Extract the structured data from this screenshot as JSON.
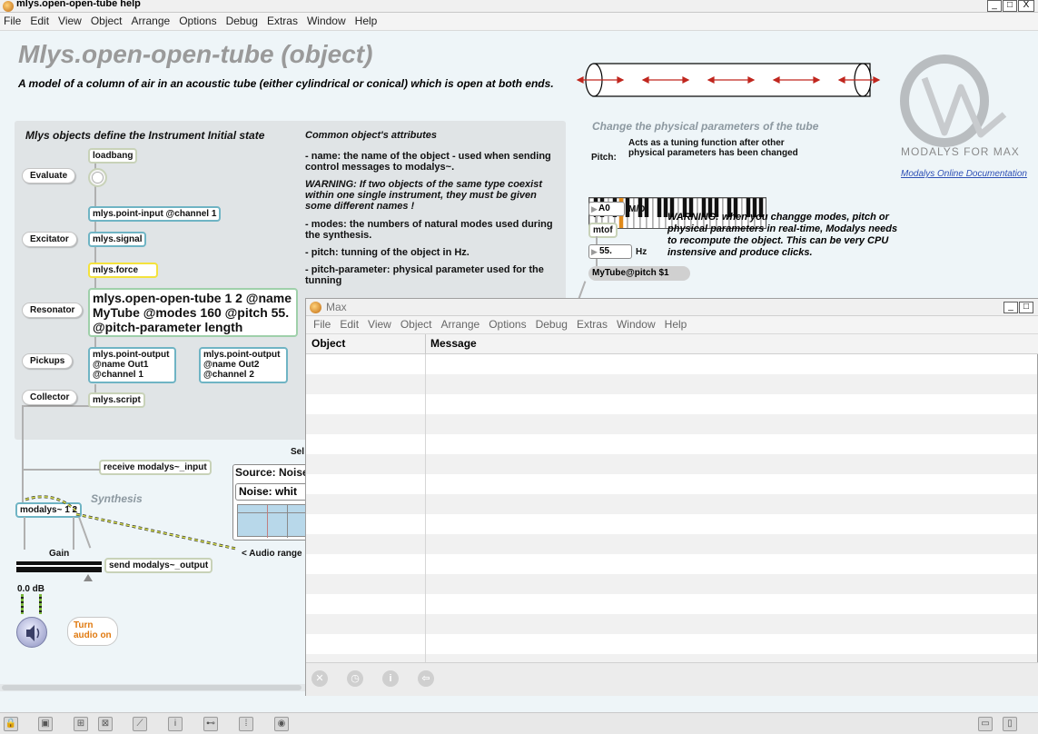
{
  "window": {
    "title": "mlys.open-open-tube help",
    "buttons": {
      "minimize": "_",
      "maximize": "□",
      "close": "X"
    }
  },
  "menubar": [
    "File",
    "Edit",
    "View",
    "Object",
    "Arrange",
    "Options",
    "Debug",
    "Extras",
    "Window",
    "Help"
  ],
  "header": {
    "title": "Mlys.open-open-tube (object)",
    "description": "A model of a column of air in an acoustic tube (either cylindrical or conical) which is open at both ends."
  },
  "logo": {
    "text": "MODALYS FOR MAX",
    "link": "Modalys Online Documentation"
  },
  "panel": {
    "title": "Mlys objects define  the Instrument Initial state",
    "labels": [
      "Evaluate",
      "Excitator",
      "Resonator",
      "Pickups",
      "Collector"
    ],
    "objects": {
      "loadbang": "loadbang",
      "point_input": "mlys.point-input @channel 1",
      "signal": "mlys.signal",
      "force": "mlys.force",
      "tube": "mlys.open-open-tube 1 2 @name MyTube @modes 160 @pitch 55. @pitch-parameter length",
      "point_output1": "mlys.point-output @name Out1 @channel 1",
      "point_output2": "mlys.point-output @name Out2 @channel 2",
      "script": "mlys.script"
    },
    "attributes_title": "Common object's attributes",
    "attr_name": "- name: the name of the object - used when sending control messages to modalys~.",
    "attr_warning": "WARNING:  If two objects of the same type coexist within one single instrument, they must be given some different names !",
    "attr_modes": "- modes: the numbers of natural modes used during the synthesis.",
    "attr_pitch": "- pitch: tunning of the object in Hz.",
    "attr_pitch_param": "- pitch-parameter: physical parameter used for the tunning",
    "attr_cut": "..."
  },
  "tube_section": {
    "title": "Change the physical parameters of the tube",
    "pitch_label": "Pitch:",
    "tuning_note": "Acts as a tuning function after other physical parameters has been changed",
    "note_box": "A0",
    "note_unit": "M/D/",
    "mtof": "mtof",
    "hz_value": "55.",
    "hz_unit": "Hz",
    "message": "MyTube@pitch $1",
    "warning": "WARNING: when you changge modes, pitch or physical parameters in real-time, Modalys needs to recompute the object. This can be very CPU instensive and produce clicks."
  },
  "synthesis": {
    "receive": "receive modalys~_input",
    "label": "Synthesis",
    "modalys": "modalys~ 1 2",
    "gain_label": "Gain",
    "send": "send modalys~_output",
    "db": "0.0 dB",
    "audio_on": "Turn audio on",
    "source_label": "Source: Noise",
    "noise_label": "Noise: whit",
    "selector_cut": "Sel",
    "audio_range": "< Audio range"
  },
  "console": {
    "title": "Max",
    "menubar": [
      "File",
      "Edit",
      "View",
      "Object",
      "Arrange",
      "Options",
      "Debug",
      "Extras",
      "Window",
      "Help"
    ],
    "columns": [
      "Object",
      "Message"
    ]
  },
  "colors": {
    "accent_teal": "#6fb4c4",
    "patch_bg": "#eef5f8",
    "panel_bg": "#e0e4e6",
    "title_gray": "#9a9a9a",
    "link_blue": "#2d4fb5",
    "orange": "#e07a10",
    "arrow_red": "#c0261e"
  }
}
